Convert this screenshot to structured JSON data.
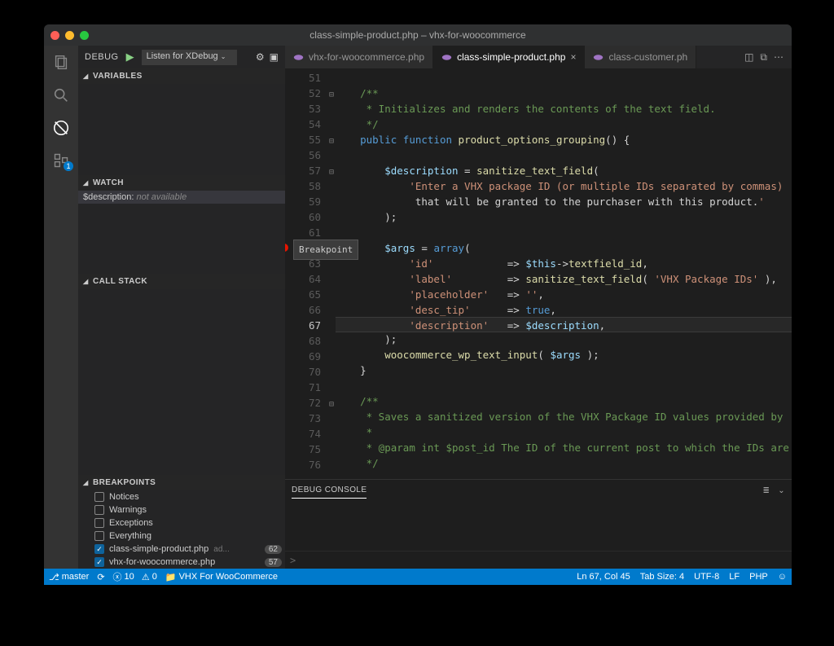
{
  "titlebar": "class-simple-product.php – vhx-for-woocommerce",
  "sidebar": {
    "debugLabel": "DEBUG",
    "configName": "Listen for XDebug",
    "sections": {
      "variables": "VARIABLES",
      "watch": "WATCH",
      "callstack": "CALL STACK",
      "breakpoints": "BREAKPOINTS"
    },
    "watch": {
      "expr": "$description",
      "value": "not available"
    },
    "breakpoints": [
      {
        "label": "Notices",
        "checked": false
      },
      {
        "label": "Warnings",
        "checked": false
      },
      {
        "label": "Exceptions",
        "checked": false
      },
      {
        "label": "Everything",
        "checked": false
      },
      {
        "label": "class-simple-product.php",
        "meta": "ad...",
        "count": "62",
        "checked": true
      },
      {
        "label": "vhx-for-woocommerce.php",
        "meta": "",
        "count": "57",
        "checked": true
      }
    ],
    "tooltip": "Breakpoint",
    "badge": "1"
  },
  "tabs": [
    {
      "label": "vhx-for-woocommerce.php",
      "active": false,
      "close": false
    },
    {
      "label": "class-simple-product.php",
      "active": true,
      "close": true
    },
    {
      "label": "class-customer.ph",
      "active": false,
      "close": false
    }
  ],
  "code": {
    "startLine": 51,
    "currentLine": 67,
    "breakpointLine": 62,
    "lines": [
      "",
      "/**",
      " * Initializes and renders the contents of the text field.",
      " */",
      "public function product_options_grouping() {",
      "",
      "    $description = sanitize_text_field(",
      "        'Enter a VHX package ID (or multiple IDs separated by commas)",
      "         that will be granted to the purchaser with this product.'",
      "    );",
      "",
      "    $args = array(",
      "        'id'            => $this->textfield_id,",
      "        'label'         => sanitize_text_field( 'VHX Package IDs' ),",
      "        'placeholder'   => '',",
      "        'desc_tip'      => true,",
      "        'description'   => $description,",
      "    );",
      "    woocommerce_wp_text_input( $args );",
      "}",
      "",
      "/**",
      " * Saves a sanitized version of the VHX Package ID values provided by ",
      " *",
      " * @param int $post_id The ID of the current post to which the IDs are",
      " */"
    ]
  },
  "panel": {
    "title": "DEBUG CONSOLE",
    "prompt": ">"
  },
  "status": {
    "branch": "master",
    "errors": "10",
    "warnings": "0",
    "project": "VHX For WooCommerce",
    "lncol": "Ln 67, Col 45",
    "tabsize": "Tab Size: 4",
    "encoding": "UTF-8",
    "eol": "LF",
    "lang": "PHP"
  }
}
